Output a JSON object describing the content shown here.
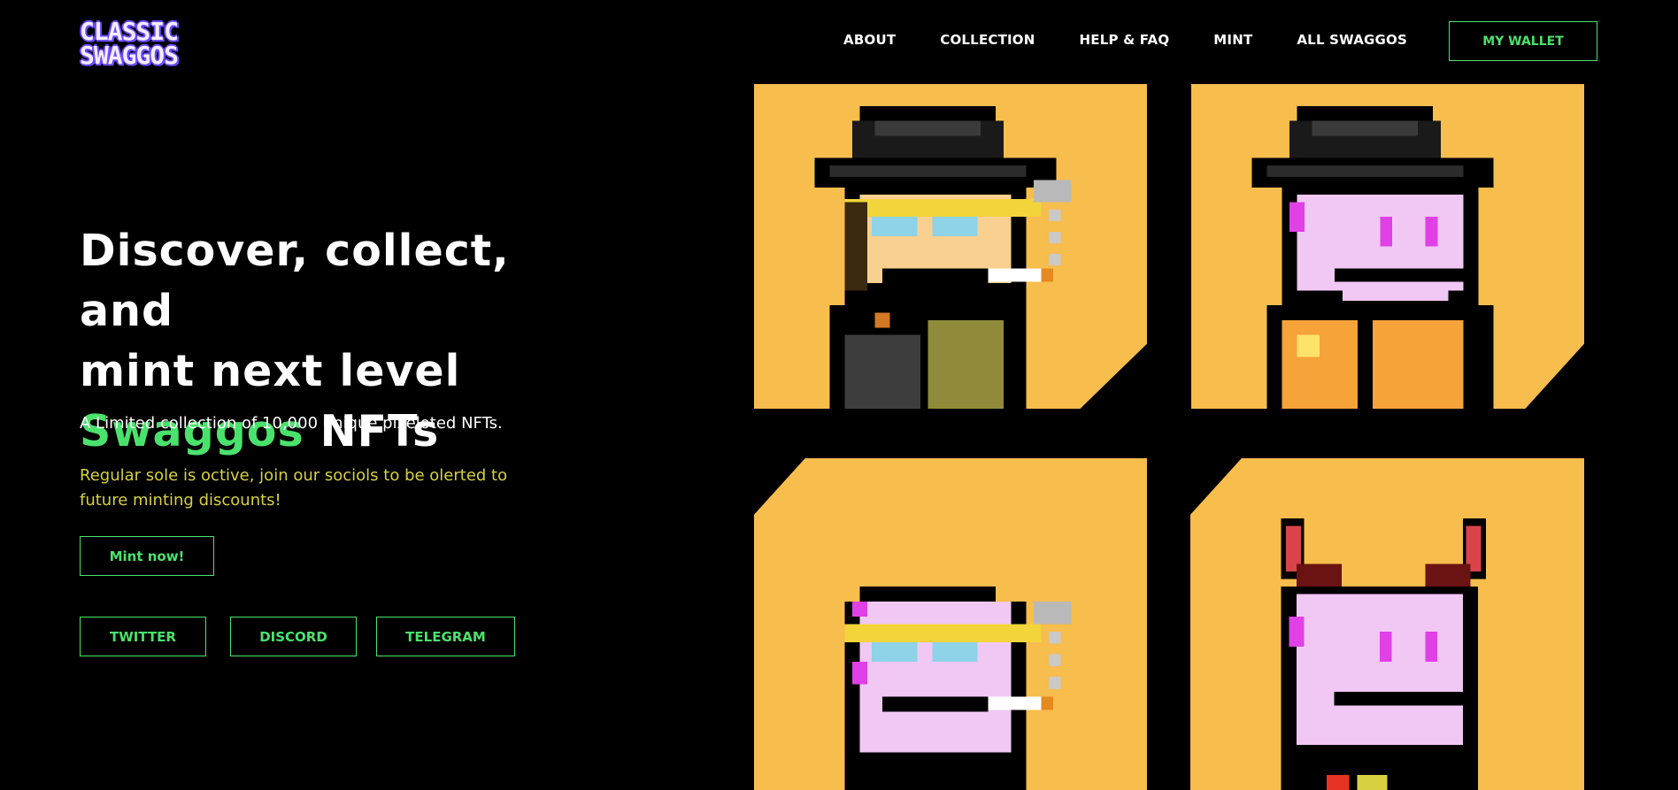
{
  "logo": {
    "line1": "CLASSIC",
    "line2": "SWAGGOS"
  },
  "nav": {
    "items": [
      "ABOUT",
      "COLLECTION",
      "HELP & FAQ",
      "MINT",
      "ALL SWAGGOS"
    ],
    "wallet_label": "MY WALLET"
  },
  "hero": {
    "title_line1": "Discover, collect, and",
    "title_line2": "mint next level",
    "title_accent": "Swaggos",
    "title_end": " NFTs",
    "subtitle": "A Limited collection of 10,000 unique pixeloted NFTs.",
    "notice": "Regular sole is octive, join our sociols to be olerted to future minting discounts!",
    "mint_label": "Mint now!",
    "socials": [
      "TWITTER",
      "DISCORD",
      "TELEGRAM"
    ]
  },
  "colors": {
    "accent": "#4ae26c",
    "notice": "#d7d041",
    "tile_bg": "#f7bd4d",
    "background": "#000000"
  }
}
